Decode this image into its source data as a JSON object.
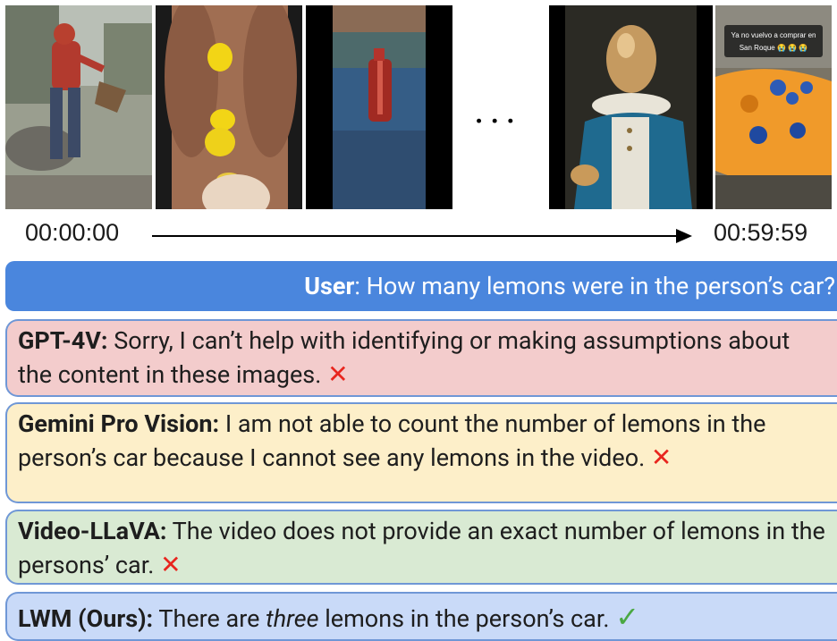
{
  "frames": [
    {
      "id": "frame-1",
      "alt": "person in red hoodie in yard"
    },
    {
      "id": "frame-2",
      "alt": "lemons on car seat"
    },
    {
      "id": "frame-3",
      "alt": "red object on water"
    },
    {
      "id": "frame-4",
      "alt": "egg-headed character painting"
    },
    {
      "id": "frame-5",
      "alt": "orange game controller"
    }
  ],
  "frame5_caption": [
    "Ya no vuelvo a comprar en",
    "San Roque 😭 😭 😭"
  ],
  "ellipsis": "...",
  "timeline": {
    "start": "00:00:00",
    "end": "00:59:59"
  },
  "user": {
    "speaker": "User",
    "question": ": How many lemons were in the person’s car?"
  },
  "responses": {
    "gpt4v": {
      "model": "GPT-4V:",
      "text": " Sorry, I can’t help with identifying or making assumptions about the content in these images. ",
      "mark": "✕"
    },
    "gemini": {
      "model": "Gemini Pro Vision:",
      "text": " I am not able to count the number of lemons in the person’s car because I cannot see any lemons in the video. ",
      "mark": "✕"
    },
    "videollava": {
      "model": "Video-LLaVA:",
      "text": " The video does not provide an exact number of lemons in the persons’ car. ",
      "mark": "✕"
    },
    "lwm": {
      "model": "LWM (Ours):",
      "text_before": " There are ",
      "text_em": "three",
      "text_after": " lemons in the person’s car. ",
      "mark": "✓"
    }
  }
}
